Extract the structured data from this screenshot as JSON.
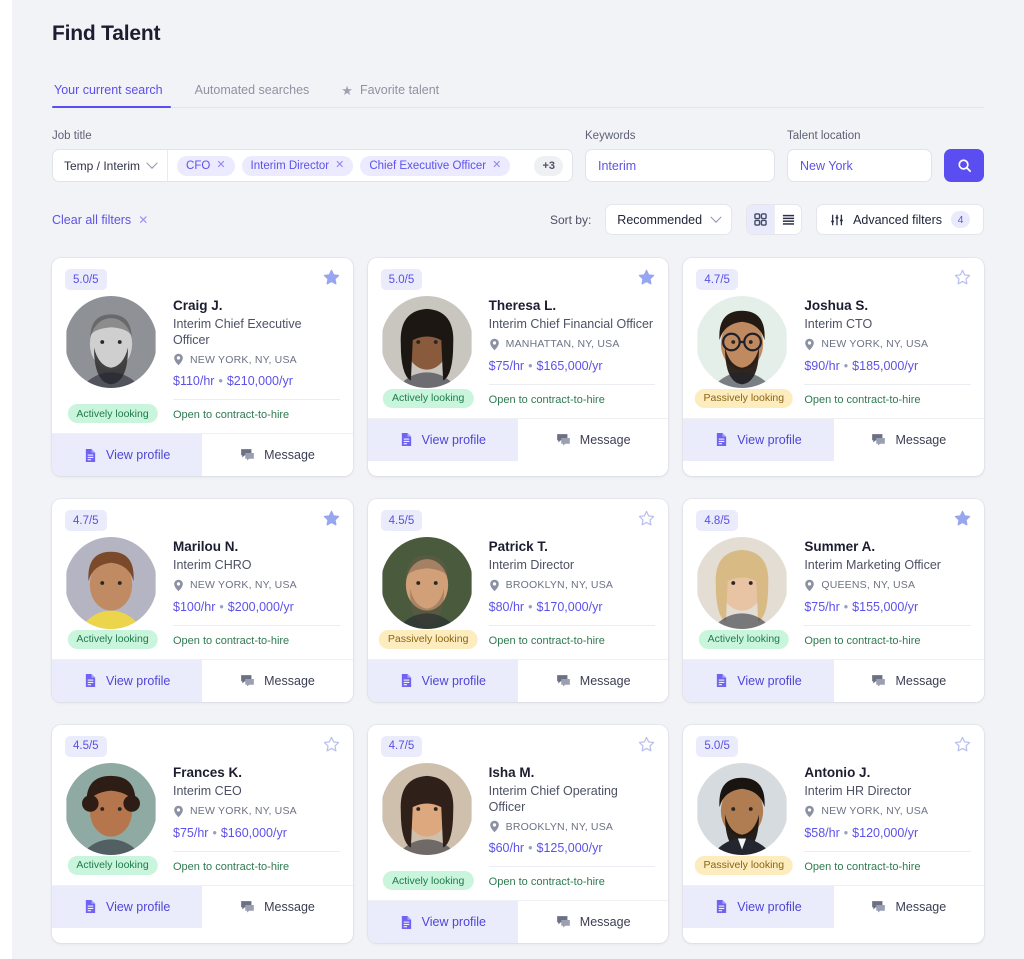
{
  "header": {
    "title": "Find Talent"
  },
  "tabs": [
    {
      "label": "Your current search",
      "active": true,
      "icon": null
    },
    {
      "label": "Automated searches",
      "active": false,
      "icon": null
    },
    {
      "label": "Favorite talent",
      "active": false,
      "icon": "star-icon"
    }
  ],
  "filters": {
    "job_title": {
      "label": "Job title",
      "select_value": "Temp / Interim",
      "chips": [
        "CFO",
        "Interim Director",
        "Chief Executive Officer"
      ],
      "more_count": "+3"
    },
    "keywords": {
      "label": "Keywords",
      "value": "Interim",
      "placeholder": "Interim"
    },
    "location": {
      "label": "Talent location",
      "value": "New York",
      "placeholder": "New York"
    },
    "search_button": "search-icon"
  },
  "toolbar": {
    "clear_filters": "Clear all filters",
    "sort_label": "Sort by:",
    "sort_value": "Recommended",
    "view_grid": "grid-view",
    "view_list": "list-view",
    "advanced_filters": "Advanced filters",
    "advanced_filters_count": "4"
  },
  "card_actions": {
    "view_profile": "View profile",
    "message": "Message"
  },
  "colors": {
    "accent": "#5b4ef0",
    "accent_soft": "#eaecfb",
    "chip_bg": "#eceaff",
    "status_active_bg": "#c9f5dc",
    "status_passive_bg": "#fcecbe",
    "open_text": "#2f7a52",
    "page_bg": "#f2f3f6"
  },
  "candidates": [
    {
      "rating": "5.0/5",
      "favorite": true,
      "name": "Craig J.",
      "role": "Interim Chief Executive Officer",
      "location": "NEW YORK, NY, USA",
      "hourly": "$110/hr",
      "yearly": "$210,000/yr",
      "status": "Actively looking",
      "status_type": "active",
      "open_note": "Open to contract-to-hire",
      "avatar": {
        "type": "photo-male-bearded-bald",
        "bg": "#8e9196",
        "skin": "#cfcfcf",
        "hair": "#3a3a3a"
      }
    },
    {
      "rating": "5.0/5",
      "favorite": true,
      "name": "Theresa L.",
      "role": "Interim Chief Financial Officer",
      "location": "MANHATTAN, NY, USA",
      "hourly": "$75/hr",
      "yearly": "$165,000/yr",
      "status": "Actively looking",
      "status_type": "active",
      "open_note": "Open to contract-to-hire",
      "avatar": {
        "type": "photo-female-dark-long-hair",
        "bg": "#c9c6c0",
        "skin": "#8a5a3c",
        "hair": "#1d1713"
      }
    },
    {
      "rating": "4.7/5",
      "favorite": false,
      "name": "Joshua S.",
      "role": "Interim CTO",
      "location": "NEW YORK, NY, USA",
      "hourly": "$90/hr",
      "yearly": "$185,000/yr",
      "status": "Passively looking",
      "status_type": "passive",
      "open_note": "Open to contract-to-hire",
      "avatar": {
        "type": "photo-male-glasses-beard",
        "bg": "#e5efe9",
        "skin": "#c08a61",
        "hair": "#241a14"
      }
    },
    {
      "rating": "4.7/5",
      "favorite": true,
      "name": "Marilou N.",
      "role": "Interim CHRO",
      "location": "NEW YORK, NY, USA",
      "hourly": "$100/hr",
      "yearly": "$200,000/yr",
      "status": "Actively looking",
      "status_type": "active",
      "open_note": "Open to contract-to-hire",
      "avatar": {
        "type": "photo-female-yellow-top",
        "bg": "#b4b4c2",
        "skin": "#c08a62",
        "hair": "#7a4a2a"
      }
    },
    {
      "rating": "4.5/5",
      "favorite": false,
      "name": "Patrick T.",
      "role": "Interim Director",
      "location": "BROOKLYN, NY, USA",
      "hourly": "$80/hr",
      "yearly": "$170,000/yr",
      "status": "Passively looking",
      "status_type": "passive",
      "open_note": "Open to contract-to-hire",
      "avatar": {
        "type": "photo-male-bald-stubble",
        "bg": "#4a5a3c",
        "skin": "#d1a078",
        "hair": "#6b5a48"
      }
    },
    {
      "rating": "4.8/5",
      "favorite": true,
      "name": "Summer A.",
      "role": "Interim Marketing Officer",
      "location": "QUEENS, NY, USA",
      "hourly": "$75/hr",
      "yearly": "$155,000/yr",
      "status": "Actively looking",
      "status_type": "active",
      "open_note": "Open to contract-to-hire",
      "avatar": {
        "type": "photo-female-blonde",
        "bg": "#e3ddd3",
        "skin": "#e8c4a4",
        "hair": "#d8bb84"
      }
    },
    {
      "rating": "4.5/5",
      "favorite": false,
      "name": "Frances K.",
      "role": "Interim CEO",
      "location": "NEW YORK, NY, USA",
      "hourly": "$75/hr",
      "yearly": "$160,000/yr",
      "status": "Actively looking",
      "status_type": "active",
      "open_note": "Open to contract-to-hire",
      "avatar": {
        "type": "photo-female-curly",
        "bg": "#8fa9a3",
        "skin": "#b5764e",
        "hair": "#2d1d14"
      }
    },
    {
      "rating": "4.7/5",
      "favorite": false,
      "name": "Isha M.",
      "role": "Interim Chief Operating Officer",
      "location": "BROOKLYN, NY, USA",
      "hourly": "$60/hr",
      "yearly": "$125,000/yr",
      "status": "Actively looking",
      "status_type": "active",
      "open_note": "Open to contract-to-hire",
      "avatar": {
        "type": "photo-female-brunette-wavy",
        "bg": "#cfc0ae",
        "skin": "#dda87e",
        "hair": "#30201a"
      }
    },
    {
      "rating": "5.0/5",
      "favorite": false,
      "name": "Antonio J.",
      "role": "Interim HR Director",
      "location": "NEW YORK, NY, USA",
      "hourly": "$58/hr",
      "yearly": "$120,000/yr",
      "status": "Passively looking",
      "status_type": "passive",
      "open_note": "Open to contract-to-hire",
      "avatar": {
        "type": "photo-male-suit-beard",
        "bg": "#d6dbdf",
        "skin": "#b07c52",
        "hair": "#1a1410"
      }
    }
  ]
}
